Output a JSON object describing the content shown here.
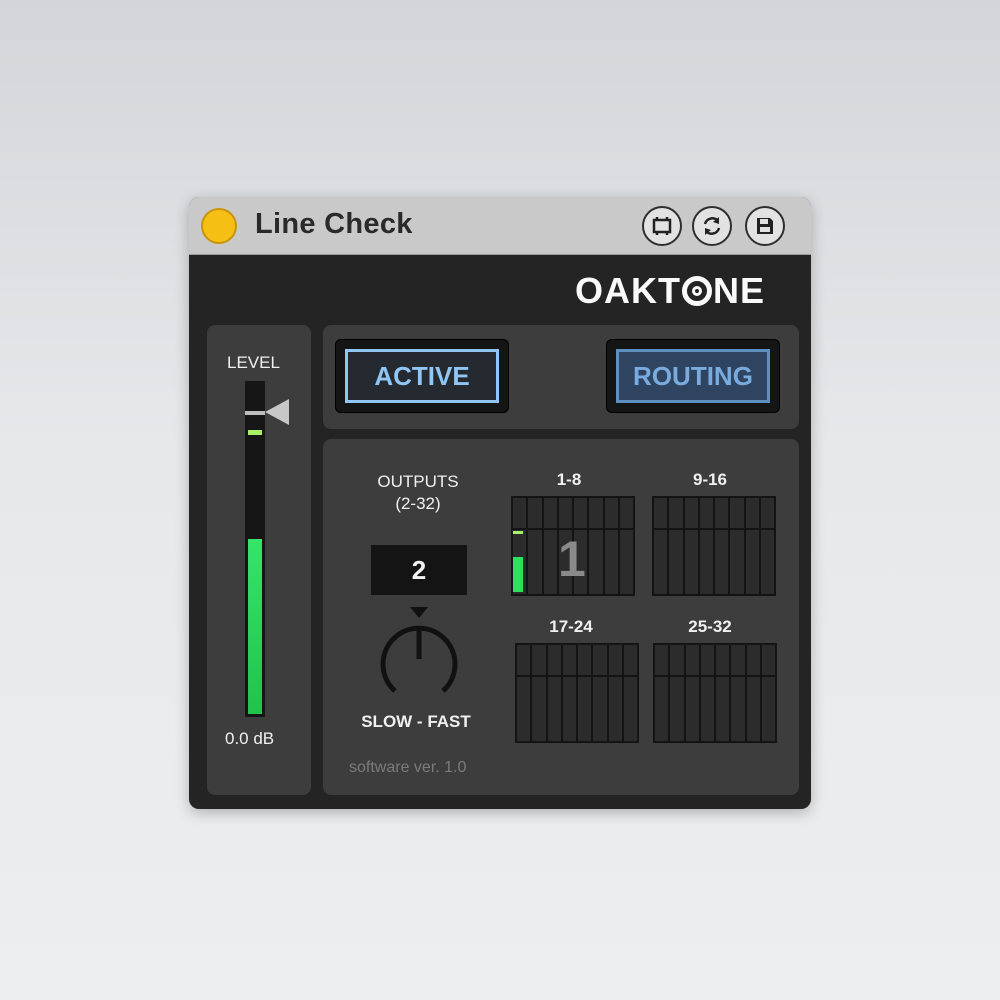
{
  "window": {
    "title": "Line Check",
    "titlebar_buttons": [
      {
        "name": "freeze-icon"
      },
      {
        "name": "refresh-icon"
      },
      {
        "name": "save-icon"
      }
    ]
  },
  "logo": {
    "pre": "OAKT",
    "post": "NE"
  },
  "level": {
    "label": "LEVEL",
    "value": "0.0 dB",
    "fill_fraction": 0.53,
    "peak_fraction": 0.86
  },
  "buttons": {
    "active_label": "ACTIVE",
    "routing_label": "ROUTING"
  },
  "outputs": {
    "label_line1": "OUTPUTS",
    "label_line2": "(2-32)",
    "value": "2"
  },
  "knob": {
    "label": "SLOW - FAST"
  },
  "version": "software ver. 1.0",
  "banks": [
    {
      "label": "1-8",
      "highlight": "1"
    },
    {
      "label": "9-16"
    },
    {
      "label": "17-24"
    },
    {
      "label": "25-32"
    }
  ],
  "colors": {
    "title_dot": "#f5bf14",
    "meter_green": "#2ee060",
    "active_blue": "#8fc6f6",
    "routing_blue": "#5d8fc3"
  }
}
